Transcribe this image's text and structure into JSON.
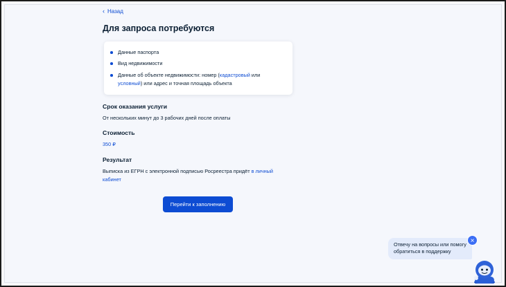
{
  "nav": {
    "back_label": "Назад"
  },
  "page": {
    "title": "Для запроса потребуются"
  },
  "requirements": [
    {
      "text": "Данные паспорта"
    },
    {
      "text": "Вид недвижимости"
    },
    {
      "pre": "Данные об объекте недвижимости: номер (",
      "link1": "кадастровый",
      "mid": " или",
      "link2": "условный",
      "post": ") или адрес и точная площадь объекта"
    }
  ],
  "service_term": {
    "heading": "Срок оказания услуги",
    "text": "От нескольких минут до 3 рабочих дней после оплаты"
  },
  "cost": {
    "heading": "Стоимость",
    "value": "350 ₽"
  },
  "result": {
    "heading": "Результат",
    "text": "Выписка из ЕГРН с электронной подписью Росреестра придёт ",
    "link_part1": "в личный",
    "link_part2": "кабинет"
  },
  "actions": {
    "submit_label": "Перейти к заполнению"
  },
  "assistant": {
    "line1": "Отвечу на вопросы или помогу",
    "line2": "обратиться в поддержку",
    "close_symbol": "×"
  },
  "colors": {
    "accent": "#0d4cd3",
    "background": "#f5f7fc",
    "text": "#0b1f33"
  }
}
